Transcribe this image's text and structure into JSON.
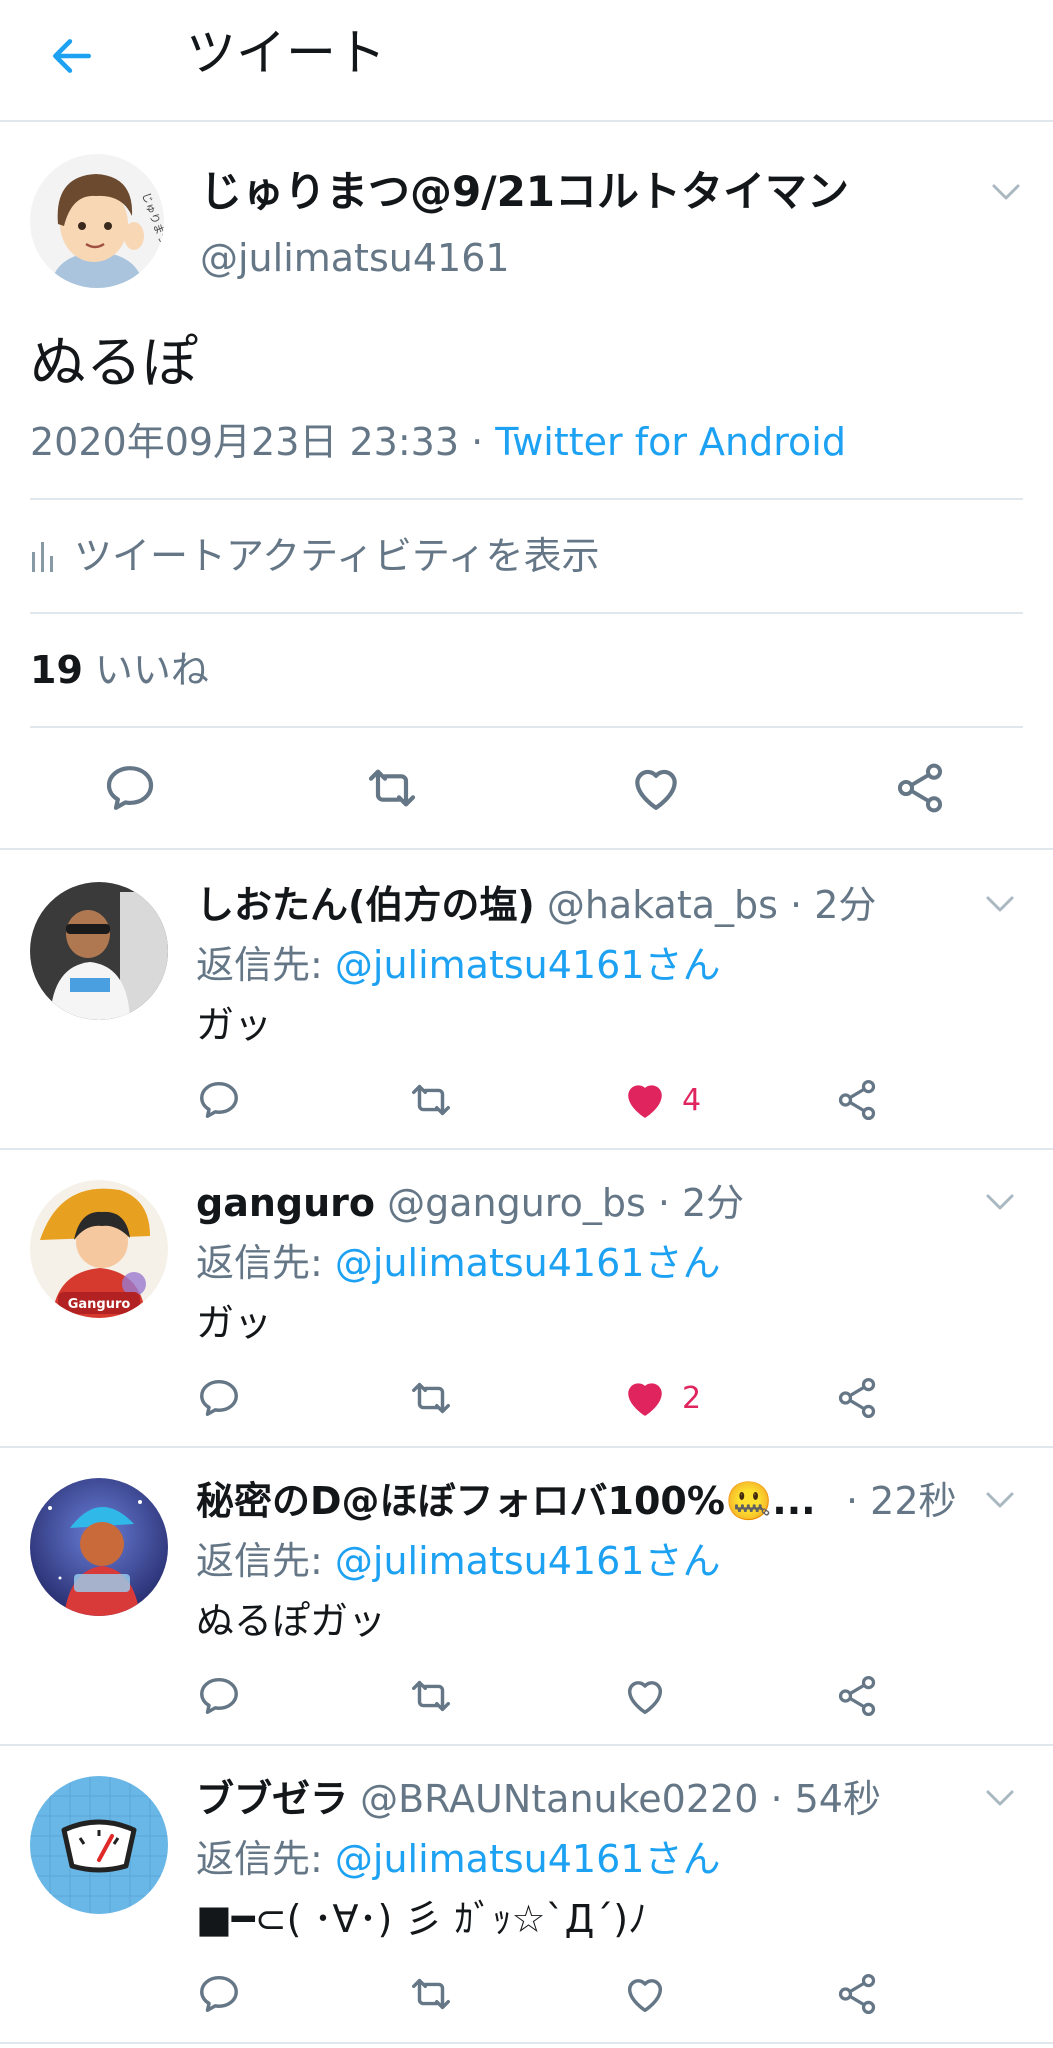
{
  "colors": {
    "accent": "#1da1f2",
    "like": "#e0245e",
    "muted": "#657786",
    "divider": "#e1e8ed"
  },
  "header": {
    "title": "ツイート",
    "back_icon": "arrow-left-icon"
  },
  "tweet": {
    "display_name": "じゅりまつ@9/21コルトタイマン",
    "handle": "@julimatsu4161",
    "text": "ぬるぽ",
    "timestamp": "2020年09月23日 23:33",
    "separator": " · ",
    "source": "Twitter for Android",
    "activity_label": "ツイートアクティビティを表示",
    "like_count": "19",
    "like_label": "いいね"
  },
  "replies": [
    {
      "display_name": "しおたん(伯方の塩)",
      "handle": "@hakata_bs",
      "time": " · 2分",
      "reply_prefix": "返信先: ",
      "reply_mention": "@julimatsu4161さん",
      "text": "ガッ",
      "like_count": "4",
      "liked": true
    },
    {
      "display_name": "ganguro",
      "handle": "@ganguro_bs",
      "time": " · 2分",
      "reply_prefix": "返信先: ",
      "reply_mention": "@julimatsu4161さん",
      "text": "ガッ",
      "like_count": "2",
      "liked": true,
      "avatar_label": "Ganguro"
    },
    {
      "display_name": "秘密のD@ほぼフォロバ100%🤐...",
      "handle": "",
      "time": " · 22秒",
      "reply_prefix": "返信先: ",
      "reply_mention": "@julimatsu4161さん",
      "text": "ぬるぽガッ",
      "like_count": "",
      "liked": false
    },
    {
      "display_name": "ブブゼラ",
      "handle": "@BRAUNtanuke0220",
      "time": " · 54秒",
      "reply_prefix": "返信先: ",
      "reply_mention": "@julimatsu4161さん",
      "text": "■━⊂( ･∀･) 彡 ｶﾞｯ☆`Д´)ﾉ",
      "like_count": "",
      "liked": false
    }
  ]
}
